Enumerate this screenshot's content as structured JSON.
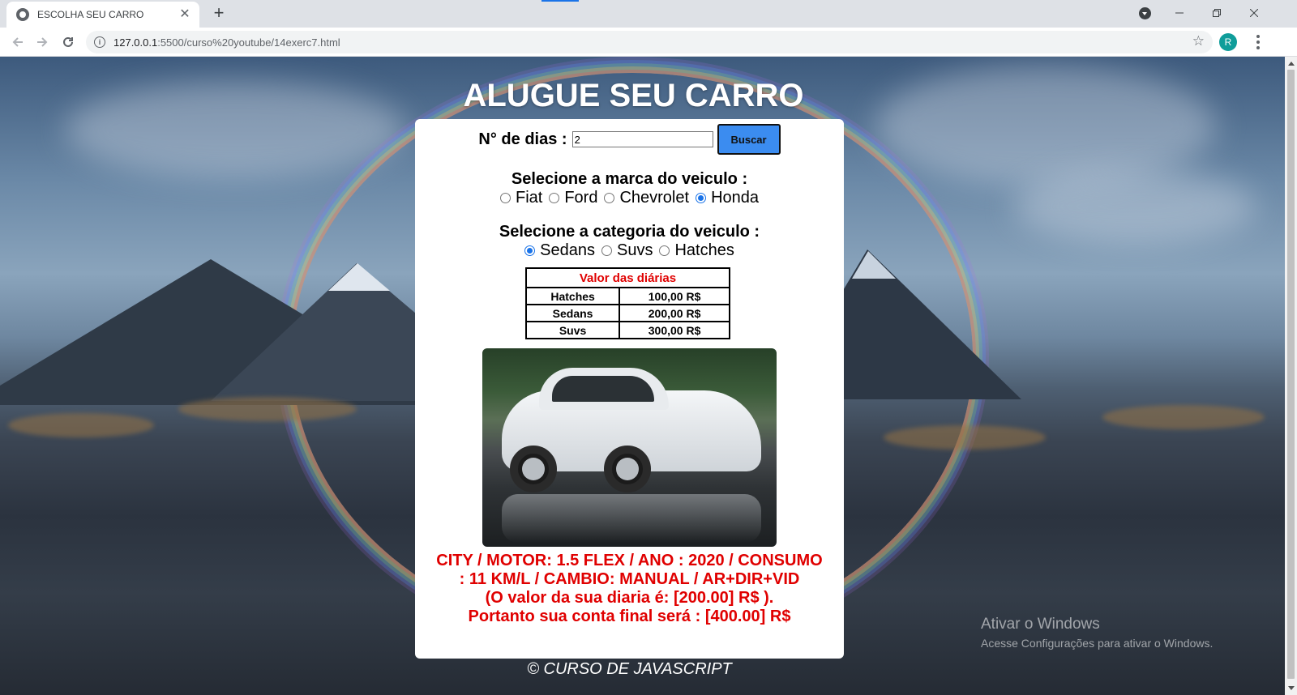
{
  "browser": {
    "tab_title": "ESCOLHA SEU CARRO",
    "tab_close": "✕",
    "new_tab": "+",
    "url_host": "127.0.0.1",
    "url_rest": ":5500/curso%20youtube/14exerc7.html",
    "profile_initial": "R",
    "icons": [
      "favicon-icon",
      "back-icon",
      "forward-icon",
      "reload-icon",
      "info-icon",
      "star-icon",
      "menu-icon"
    ]
  },
  "page": {
    "title": "ALUGUE SEU CARRO",
    "dias_label": "N° de dias :",
    "dias_value": "2",
    "buscar_label": "Buscar",
    "marca_question": "Selecione a marca do veiculo :",
    "marcas": [
      {
        "label": "Fiat",
        "checked": false
      },
      {
        "label": "Ford",
        "checked": false
      },
      {
        "label": "Chevrolet",
        "checked": false
      },
      {
        "label": "Honda",
        "checked": true
      }
    ],
    "categoria_question": "Selecione a categoria do veiculo :",
    "categorias": [
      {
        "label": "Sedans",
        "checked": true
      },
      {
        "label": "Suvs",
        "checked": false
      },
      {
        "label": "Hatches",
        "checked": false
      }
    ],
    "table": {
      "header": "Valor das diárias",
      "rows": [
        {
          "categoria": "Hatches",
          "valor": "100,00 R$"
        },
        {
          "categoria": "Sedans",
          "valor": "200,00 R$"
        },
        {
          "categoria": "Suvs",
          "valor": "300,00 R$"
        }
      ]
    },
    "desc_line1": "CITY / MOTOR: 1.5 FLEX / ANO : 2020 / CONSUMO",
    "desc_line2": ": 11 KM/L / CAMBIO: MANUAL / AR+DIR+VID",
    "desc_line3": "(O valor da sua diaria é: [200.00] R$ ).",
    "desc_line4": "Portanto sua conta final será : [400.00] R$",
    "footer": "© CURSO DE JAVASCRIPT"
  },
  "windows_watermark": {
    "line1": "Ativar o Windows",
    "line2": "Acesse Configurações para ativar o Windows."
  },
  "colors": {
    "accent_button": "#3b8cf0",
    "highlight_red": "#e00000",
    "radio_checked": "#1a73e8"
  }
}
